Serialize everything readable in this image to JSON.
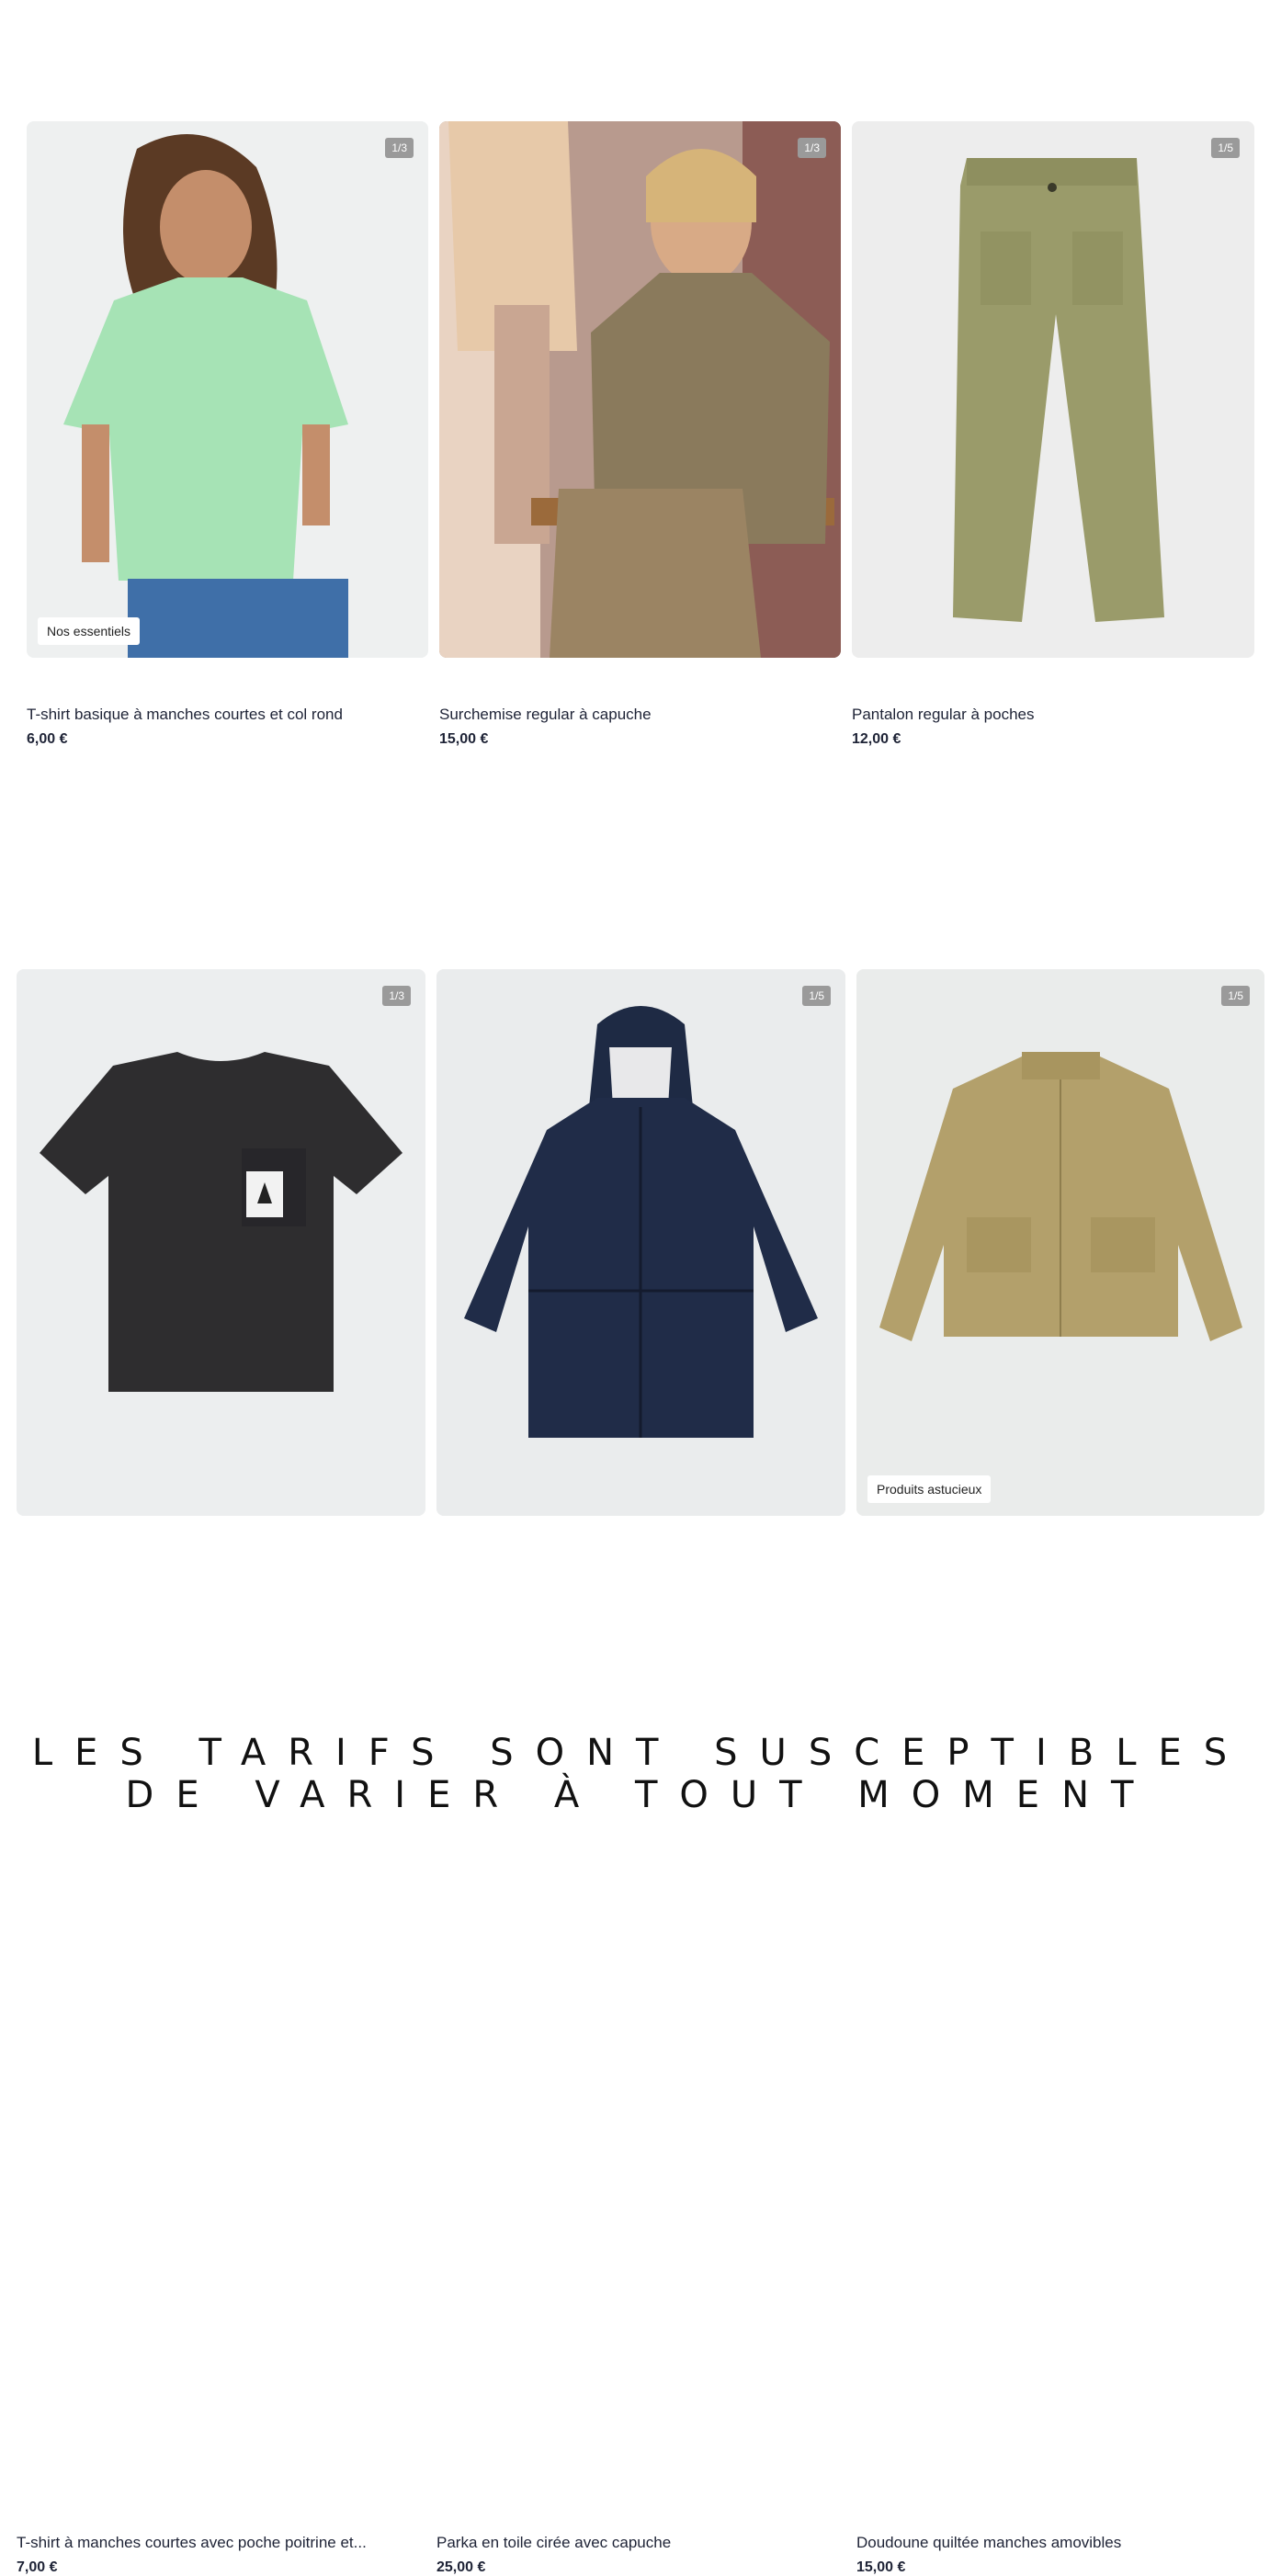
{
  "products": [
    {
      "title": "T-shirt basique à manches courtes et col rond",
      "price": "6,00 €",
      "counter": "1/3",
      "tag": "Nos essentiels",
      "image": "green-tshirt-child-photo"
    },
    {
      "title": "Surchemise regular à capuche",
      "price": "15,00 €",
      "counter": "1/3",
      "tag": "",
      "image": "khaki-overshirt-child-photo"
    },
    {
      "title": "Pantalon regular à poches",
      "price": "12,00 €",
      "counter": "1/5",
      "tag": "",
      "image": "olive-trousers-photo"
    },
    {
      "title": "T-shirt à manches courtes avec poche poitrine et...",
      "price": "7,00 €",
      "counter": "1/3",
      "tag": "",
      "image": "black-pocket-tshirt-photo"
    },
    {
      "title": "Parka en toile cirée avec capuche",
      "price": "25,00 €",
      "counter": "1/5",
      "tag": "",
      "image": "navy-parka-photo"
    },
    {
      "title": "Doudoune quiltée manches amovibles",
      "price": "15,00 €",
      "counter": "1/5",
      "tag": "Produits astucieux",
      "image": "quilted-jacket-photo"
    }
  ],
  "disclaimer": "LES TARIFS SONT SUSCEPTIBLES DE VARIER À TOUT MOMENT"
}
